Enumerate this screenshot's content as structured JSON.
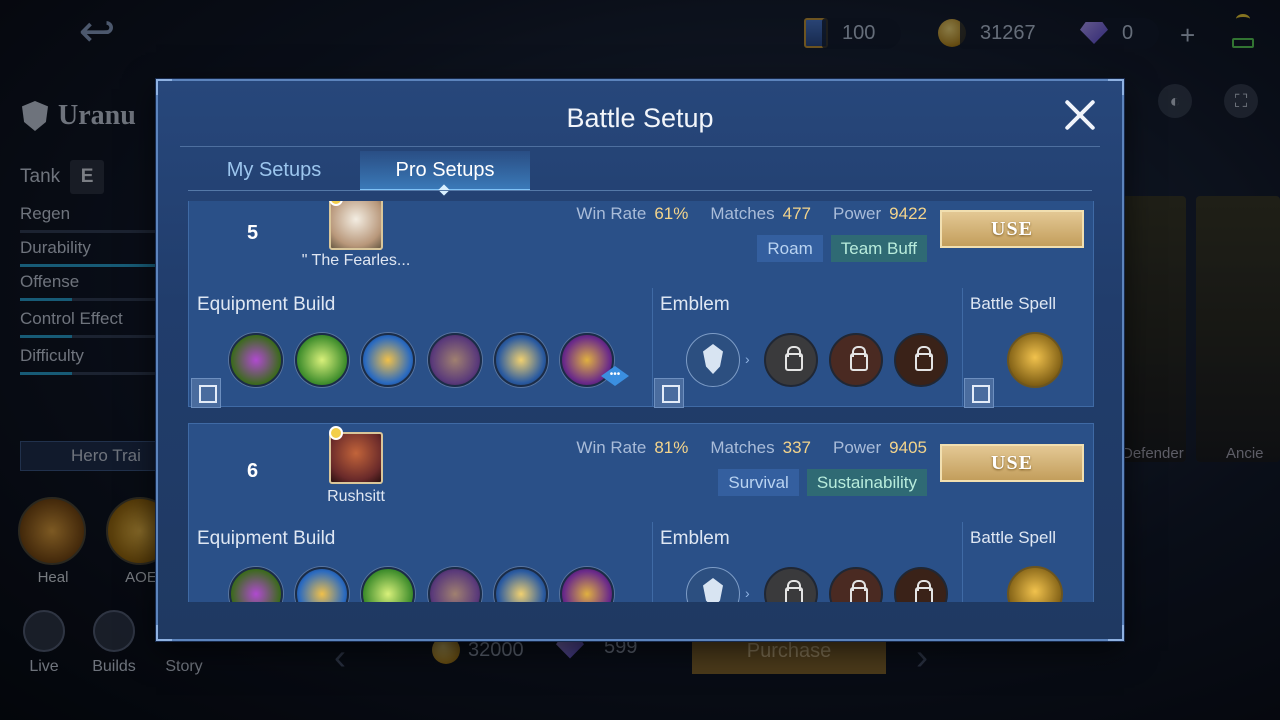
{
  "topbar": {
    "ticket_value": "100",
    "gold_value": "31267",
    "diamond_value": "0",
    "plus": "+"
  },
  "hero": {
    "name": "Uranu",
    "role": "Tank",
    "stats": [
      {
        "label": "Regen",
        "level": 0
      },
      {
        "label": "Durability",
        "level": 1.0
      },
      {
        "label": "Offense",
        "level": 0.38
      },
      {
        "label": "Control Effect",
        "level": 0.38
      },
      {
        "label": "Difficulty",
        "level": 0.38
      }
    ],
    "training_label": "Hero Trai",
    "skills": [
      "Heal",
      "AOE"
    ],
    "menu": [
      "Live",
      "Builds",
      "Story"
    ],
    "cards": [
      "Defender",
      "Ancie"
    ]
  },
  "shop": {
    "gold_price": "32000",
    "diamond_price": "599",
    "purchase_label": "Purchase"
  },
  "modal": {
    "title": "Battle Setup",
    "tabs": [
      "My Setups",
      "Pro Setups"
    ],
    "active_tab": "Pro Setups",
    "labels": {
      "win_rate": "Win Rate",
      "matches": "Matches",
      "power": "Power",
      "use": "USE",
      "equipment": "Equipment Build",
      "emblem": "Emblem",
      "spell": "Battle Spell"
    },
    "setups": [
      {
        "rank": "5",
        "player": "\" The Fearles...",
        "win_rate": "61%",
        "matches": "477",
        "power": "9422",
        "tags": [
          {
            "text": "Roam",
            "style": "blue"
          },
          {
            "text": "Team Buff",
            "style": "green"
          }
        ],
        "items": [
          "boots-icon",
          "dragon-helm-icon",
          "ring-icon",
          "spiked-armor-icon",
          "lightning-gauntlet-icon",
          "crowned-shield-icon"
        ],
        "emblems": [
          "tank-emblem-icon",
          "locked-talent-icon",
          "locked-talent-icon",
          "locked-talent-icon"
        ],
        "spell": "locked-spell-icon"
      },
      {
        "rank": "6",
        "player": "Rushsitt",
        "win_rate": "81%",
        "matches": "337",
        "power": "9405",
        "tags": [
          {
            "text": "Survival",
            "style": "blue"
          },
          {
            "text": "Sustainability",
            "style": "green"
          }
        ],
        "items": [
          "boots-icon",
          "ring-icon",
          "dragon-helm-icon",
          "spiked-armor-icon",
          "lightning-gauntlet-icon",
          "crowned-shield-icon"
        ],
        "emblems": [
          "tank-emblem-icon",
          "locked-talent-icon",
          "locked-talent-icon",
          "locked-talent-icon"
        ],
        "spell": "locked-spell-icon"
      }
    ]
  },
  "colors": {
    "panel": "#27477b",
    "card": "#2a5088",
    "gold_text": "#f3d48c",
    "use_button": "#d6b878",
    "tag_blue": "#345f9f",
    "tag_green": "#2f6a74"
  }
}
